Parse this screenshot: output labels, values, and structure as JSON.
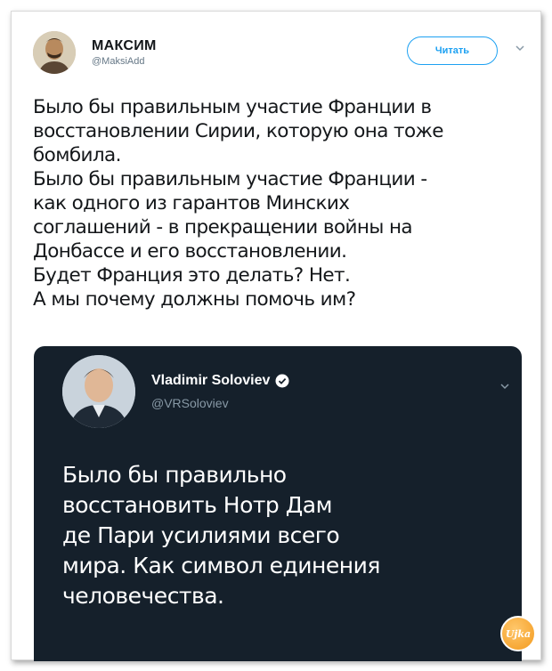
{
  "tweet": {
    "author": {
      "name": "МАКСИМ",
      "handle": "@MaksiAdd"
    },
    "follow_label": "Читать",
    "lines": [
      "Было бы правильным участие Франции в",
      "восстановлении Сирии, которую она тоже",
      "бомбила.",
      "Было бы правильным участие Франции -",
      "как одного из гарантов Минских",
      "соглашений - в прекращении войны на",
      "Донбассе и его восстановлении.",
      "Будет Франция это делать? Нет.",
      "А мы почему должны помочь им?"
    ]
  },
  "quoted": {
    "author": {
      "name": "Vladimir Soloviev",
      "handle": "@VRSoloviev"
    },
    "lines": [
      "Было бы правильно",
      "восстановить Нотр Дам",
      "де Пари усилиями всего",
      "мира. Как символ единения",
      "человечества."
    ]
  },
  "watermark": {
    "text": "Ujka"
  },
  "colors": {
    "accent": "#1da1f2",
    "dark_bg": "#15202b",
    "text_dark": "#14171a",
    "muted": "#657786"
  }
}
